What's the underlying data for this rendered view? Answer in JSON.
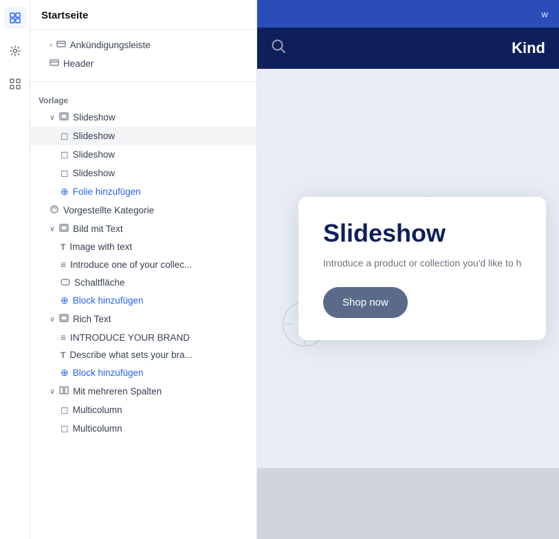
{
  "sidebar": {
    "title": "Startseite",
    "items": [
      {
        "id": "ankundigungsleiste",
        "label": "Ankündigungsleiste",
        "indent": "indent1",
        "icon": "⊟",
        "hasChevron": true
      },
      {
        "id": "header",
        "label": "Header",
        "indent": "indent1",
        "icon": "⊟",
        "hasChevron": false
      },
      {
        "id": "vorlage-section",
        "label": "Vorlage",
        "type": "section"
      },
      {
        "id": "slideshow-group",
        "label": "Slideshow",
        "indent": "indent1",
        "icon": "⊟",
        "hasChevron": true,
        "expanded": true
      },
      {
        "id": "slideshow-1",
        "label": "Slideshow",
        "indent": "indent2",
        "icon": "◻",
        "selected": true
      },
      {
        "id": "slideshow-2",
        "label": "Slideshow",
        "indent": "indent2",
        "icon": "◻"
      },
      {
        "id": "slideshow-3",
        "label": "Slideshow",
        "indent": "indent2",
        "icon": "◻"
      },
      {
        "id": "folie-hinzufugen",
        "label": "Folie hinzufügen",
        "indent": "indent2",
        "icon": "⊕",
        "isAdd": true
      },
      {
        "id": "vorgestellte-kategorie",
        "label": "Vorgestellte Kategorie",
        "indent": "indent1",
        "icon": "◎"
      },
      {
        "id": "bild-mit-text",
        "label": "Bild mit Text",
        "indent": "indent1",
        "icon": "⊟",
        "hasChevron": true,
        "expanded": true
      },
      {
        "id": "image-with-text",
        "label": "Image with text",
        "indent": "indent2",
        "icon": "T"
      },
      {
        "id": "introduce-one",
        "label": "Introduce one of your collec...",
        "indent": "indent2",
        "icon": "≡"
      },
      {
        "id": "schaltflache",
        "label": "Schaltfläche",
        "indent": "indent2",
        "icon": "⊡"
      },
      {
        "id": "block-hinzufugen-1",
        "label": "Block hinzufügen",
        "indent": "indent2",
        "icon": "⊕",
        "isAdd": true
      },
      {
        "id": "rich-text",
        "label": "Rich Text",
        "indent": "indent1",
        "icon": "⊟",
        "hasChevron": true,
        "expanded": true
      },
      {
        "id": "introduce-brand",
        "label": "INTRODUCE YOUR BRAND",
        "indent": "indent2",
        "icon": "≡"
      },
      {
        "id": "describe-brand",
        "label": "Describe what sets your bra...",
        "indent": "indent2",
        "icon": "T"
      },
      {
        "id": "block-hinzufugen-2",
        "label": "Block hinzufügen",
        "indent": "indent2",
        "icon": "⊕",
        "isAdd": true
      },
      {
        "id": "mit-mehreren-spalten",
        "label": "Mit mehreren Spalten",
        "indent": "indent1",
        "icon": "⊞",
        "hasChevron": true,
        "expanded": true
      },
      {
        "id": "multicolumn-1",
        "label": "Multicolumn",
        "indent": "indent2",
        "icon": "◻"
      },
      {
        "id": "multicolumn-2",
        "label": "Multicolumn",
        "indent": "indent2",
        "icon": "◻"
      }
    ]
  },
  "icon_rail": {
    "icons": [
      {
        "id": "sections-icon",
        "symbol": "⊞",
        "active": true
      },
      {
        "id": "settings-icon",
        "symbol": "⚙",
        "active": false
      },
      {
        "id": "apps-icon",
        "symbol": "⊞",
        "active": false
      }
    ]
  },
  "preview": {
    "topbar_text": "w",
    "brand_name": "Kind",
    "slideshow_title": "Slideshow",
    "slideshow_desc": "Introduce a product or collection you'd like to h",
    "shop_now_label": "Shop now"
  }
}
